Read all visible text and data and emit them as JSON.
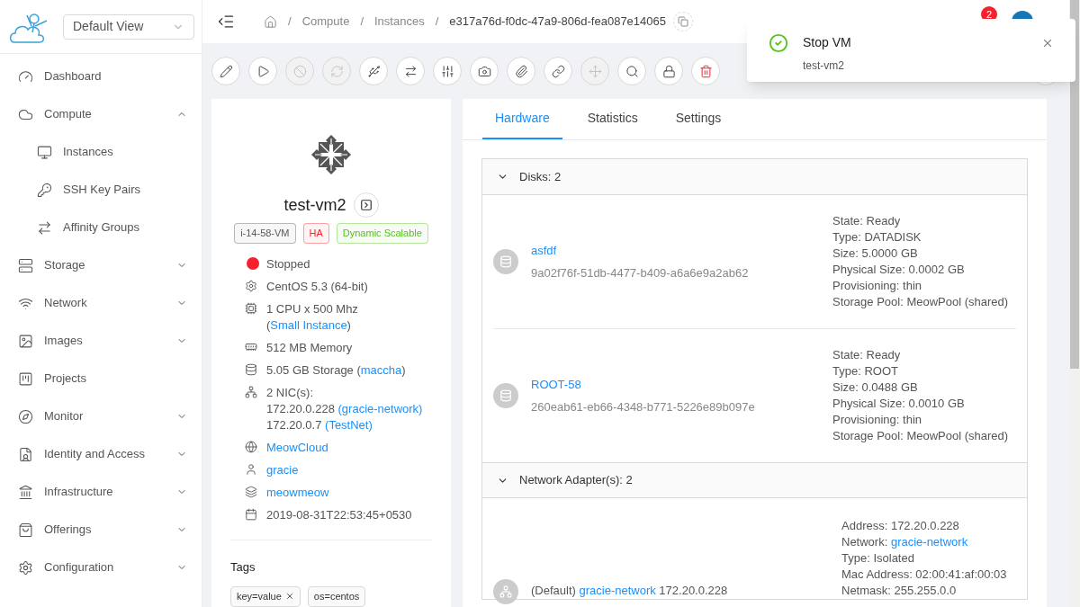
{
  "view_select": {
    "value": "Default View"
  },
  "breadcrumb": {
    "separator": "/",
    "items": [
      "Compute",
      "Instances",
      "e317a76d-f0dc-47a9-806d-fea087e14065"
    ]
  },
  "header": {
    "notification_count": "2"
  },
  "toast": {
    "title": "Stop VM",
    "message": "test-vm2"
  },
  "sidebar": {
    "items": [
      {
        "label": "Dashboard"
      },
      {
        "label": "Compute",
        "expanded": true,
        "children": [
          {
            "label": "Instances"
          },
          {
            "label": "SSH Key Pairs"
          },
          {
            "label": "Affinity Groups"
          }
        ]
      },
      {
        "label": "Storage",
        "expanded": false
      },
      {
        "label": "Network",
        "expanded": false
      },
      {
        "label": "Images",
        "expanded": false
      },
      {
        "label": "Projects"
      },
      {
        "label": "Monitor",
        "expanded": false
      },
      {
        "label": "Identity and Access",
        "expanded": false
      },
      {
        "label": "Infrastructure",
        "expanded": false
      },
      {
        "label": "Offerings",
        "expanded": false
      },
      {
        "label": "Configuration",
        "expanded": false
      }
    ]
  },
  "actions": [
    {
      "disabled": false,
      "danger": false
    },
    {
      "disabled": false,
      "danger": false
    },
    {
      "disabled": true,
      "danger": false
    },
    {
      "disabled": true,
      "danger": false
    },
    {
      "disabled": false,
      "danger": false
    },
    {
      "disabled": false,
      "danger": false
    },
    {
      "disabled": false,
      "danger": false
    },
    {
      "disabled": false,
      "danger": false
    },
    {
      "disabled": false,
      "danger": false
    },
    {
      "disabled": false,
      "danger": false
    },
    {
      "disabled": true,
      "danger": false
    },
    {
      "disabled": false,
      "danger": false
    },
    {
      "disabled": false,
      "danger": false
    },
    {
      "disabled": false,
      "danger": true
    }
  ],
  "instance": {
    "name": "test-vm2",
    "tags_top": [
      {
        "text": "i-14-58-VM",
        "color": "#595959"
      },
      {
        "text": "HA",
        "color": "#f5222d"
      },
      {
        "text": "Dynamic Scalable",
        "color": "#52c41a"
      }
    ],
    "details": [
      {
        "kind": "status",
        "color": "#f5222d",
        "lines": [
          [
            {
              "text": "Stopped",
              "kind": "text"
            }
          ]
        ]
      },
      {
        "kind": "os",
        "lines": [
          [
            {
              "text": "CentOS 5.3 (64-bit)",
              "kind": "text"
            }
          ]
        ]
      },
      {
        "kind": "cpu",
        "lines": [
          [
            {
              "text": "1 CPU x 500 Mhz (",
              "kind": "text"
            },
            {
              "text": "Small Instance",
              "kind": "link"
            },
            {
              "text": ")",
              "kind": "text"
            }
          ]
        ]
      },
      {
        "kind": "memory",
        "lines": [
          [
            {
              "text": "512 MB Memory",
              "kind": "text"
            }
          ]
        ]
      },
      {
        "kind": "storage",
        "lines": [
          [
            {
              "text": "5.05 GB Storage (",
              "kind": "text"
            },
            {
              "text": "maccha",
              "kind": "link"
            },
            {
              "text": ")",
              "kind": "text"
            }
          ]
        ]
      },
      {
        "kind": "nic",
        "lines": [
          [
            {
              "text": "2 NIC(s):",
              "kind": "text"
            }
          ],
          [
            {
              "text": "172.20.0.228 ",
              "kind": "text"
            },
            {
              "text": "(gracie-network)",
              "kind": "link"
            }
          ],
          [
            {
              "text": "172.20.0.7 ",
              "kind": "text"
            },
            {
              "text": "(TestNet)",
              "kind": "link"
            }
          ]
        ]
      },
      {
        "kind": "zone",
        "lines": [
          [
            {
              "text": "MeowCloud",
              "kind": "link"
            }
          ]
        ]
      },
      {
        "kind": "account",
        "lines": [
          [
            {
              "text": "gracie",
              "kind": "link"
            }
          ]
        ]
      },
      {
        "kind": "domain",
        "lines": [
          [
            {
              "text": "meowmeow",
              "kind": "link"
            }
          ]
        ]
      },
      {
        "kind": "created",
        "lines": [
          [
            {
              "text": "2019-08-31T22:53:45+0530",
              "kind": "text"
            }
          ]
        ]
      }
    ],
    "tags_title": "Tags",
    "tags": [
      {
        "text": "key=value",
        "closable": true
      },
      {
        "text": "os=centos",
        "closable": false
      }
    ]
  },
  "tabs": [
    {
      "label": "Hardware",
      "selected": true
    },
    {
      "label": "Statistics",
      "selected": false
    },
    {
      "label": "Settings",
      "selected": false
    }
  ],
  "disks": {
    "title": "Disks: 2",
    "expanded": true,
    "items": [
      {
        "name": "asfdf",
        "id": "9a02f76f-51db-4477-b409-a6a6e9a2ab62",
        "props": [
          "State: Ready",
          "Type: DATADISK",
          "Size: 5.0000 GB",
          "Physical Size: 0.0002 GB",
          "Provisioning: thin",
          "Storage Pool: MeowPool (shared)"
        ]
      },
      {
        "name": "ROOT-58",
        "id": "260eab61-eb66-4348-b771-5226e89b097e",
        "props": [
          "State: Ready",
          "Type: ROOT",
          "Size: 0.0488 GB",
          "Physical Size: 0.0010 GB",
          "Provisioning: thin",
          "Storage Pool: MeowPool (shared)"
        ]
      }
    ]
  },
  "nics": {
    "title": "Network Adapter(s): 2",
    "expanded": true,
    "items": [
      {
        "prefix": "(Default) ",
        "network": "gracie-network",
        "ip": " 172.20.0.228",
        "props": [
          [
            {
              "text": "Address: 172.20.0.228",
              "kind": "text"
            }
          ],
          [
            {
              "text": "Network: ",
              "kind": "text"
            },
            {
              "text": "gracie-network",
              "kind": "link"
            }
          ],
          [
            {
              "text": "Type: Isolated",
              "kind": "text"
            }
          ],
          [
            {
              "text": "Mac Address: 02:00:41:af:00:03",
              "kind": "text"
            }
          ],
          [
            {
              "text": "Netmask: 255.255.0.0",
              "kind": "text"
            }
          ]
        ]
      }
    ]
  }
}
